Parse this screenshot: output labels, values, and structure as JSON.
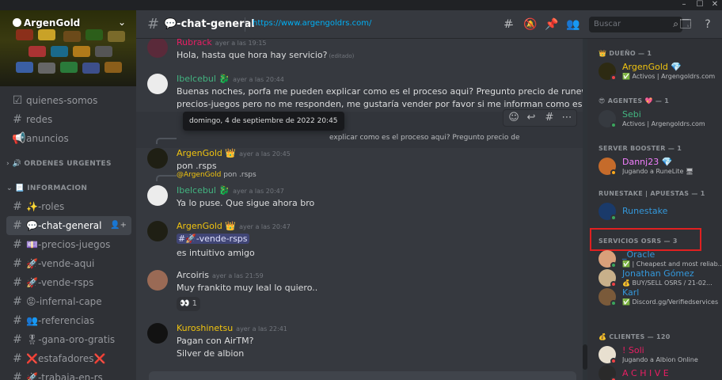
{
  "colors": {
    "accent": "#00aff4",
    "argengold": "#f1c40f",
    "green_user": "#43b581",
    "pink_user": "#f47fff",
    "online": "#3ba55d",
    "dnd": "#ed4245",
    "idle": "#faa81a",
    "highlight_box": "#e02020"
  },
  "window_controls": [
    "–",
    "☐",
    "✕"
  ],
  "server": {
    "name": "ArgenGold",
    "dropdown_icon": "chevron-down-icon"
  },
  "channels": [
    {
      "icon": "checklist-icon",
      "glyph": "☑",
      "label": "quienes-somos",
      "active": false
    },
    {
      "icon": "hash-icon",
      "glyph": "#",
      "label": "redes",
      "active": false
    },
    {
      "icon": "megaphone-icon",
      "glyph": "📢",
      "label": "anuncios",
      "active": false
    },
    {
      "category": true,
      "label": "› 🔊 ORDENES URGENTES"
    },
    {
      "category": true,
      "label": "⌄ 📃 INFORMACION"
    },
    {
      "icon": "hash-icon",
      "glyph": "#",
      "label": "✨-roles",
      "active": false
    },
    {
      "icon": "hash-icon",
      "glyph": "#",
      "label": "💬-chat-general",
      "active": true
    },
    {
      "icon": "hash-icon",
      "glyph": "#",
      "label": "💷-precios-juegos",
      "active": false
    },
    {
      "icon": "hash-icon",
      "glyph": "#",
      "label": "🚀-vende-aqui",
      "active": false
    },
    {
      "icon": "hash-icon",
      "glyph": "#",
      "label": "🚀-vende-rsps",
      "active": false
    },
    {
      "icon": "hash-icon",
      "glyph": "#",
      "label": "😡-infernal-cape",
      "active": false
    },
    {
      "icon": "hash-icon",
      "glyph": "#",
      "label": "👥-referencias",
      "active": false
    },
    {
      "icon": "hash-icon",
      "glyph": "#",
      "label": "🎖-gana-oro-gratis",
      "active": false
    },
    {
      "icon": "hash-icon",
      "glyph": "#",
      "label": "❌estafadores❌",
      "active": false
    },
    {
      "icon": "hash-icon",
      "glyph": "#",
      "label": "🚀-trabaja-en-rs",
      "active": false
    }
  ],
  "header": {
    "channel_name": "💬-chat-general",
    "topic": "https://www.argengoldrs.com/",
    "search_placeholder": "Buscar"
  },
  "messages": [
    {
      "author": "Rubrack",
      "color": "#e91e63",
      "timestamp": "ayer a las 19:15",
      "lines": [
        "Hola, hasta que hora hay servicio?"
      ],
      "edited": "(editado)"
    },
    {
      "author": "Ibelcebul",
      "badge": "🐉",
      "color": "#43b581",
      "timestamp": "ayer a las 20:44",
      "lines": [
        "Buenas noches, porfa me pueden explicar como es el proceso aqui? Pregunto precio de runewild en",
        "precios-juegos pero no me responden, me gustaría vender por favor si me informan como es todo"
      ]
    },
    {
      "reply": "explicar como es el proceso aqui? Pregunto precio de",
      "author": "ArgenGold",
      "badge": "👑",
      "color": "#f1c40f",
      "timestamp": "ayer a las 20:45",
      "lines": [
        "pon .rsps"
      ]
    },
    {
      "reply_author": "@ArgenGold",
      "reply": "pon .rsps",
      "author": "Ibelcebul",
      "badge": "🐉",
      "color": "#43b581",
      "timestamp": "ayer a las 20:47",
      "lines": [
        "Ya lo puse. Que sigue ahora bro"
      ]
    },
    {
      "author": "ArgenGold",
      "badge": "👑",
      "color": "#f1c40f",
      "timestamp": "ayer a las 20:47",
      "mention": "#🚀-vende-rsps",
      "lines": [
        "es intuitivo amigo"
      ]
    },
    {
      "author": "Arcoiris",
      "color": "#dcddde",
      "timestamp": "ayer a las 21:59",
      "lines": [
        "Muy frankito muy leal lo quiero.."
      ],
      "reaction": {
        "emoji": "👀",
        "count": "1"
      }
    },
    {
      "author": "Kuroshinetsu",
      "color": "#f1c40f",
      "timestamp": "ayer a las 22:41",
      "lines": [
        "Pagan con AirTM?",
        "Silver de albion"
      ]
    }
  ],
  "tooltip": "domingo, 4 de septiembre de 2022 20:45",
  "member_groups": [
    {
      "title": "👑 DUEÑO — 1",
      "members": [
        {
          "name": "ArgenGold",
          "name_suffix": "💎",
          "color": "#f1c40f",
          "activity": "✅ Activos | Argengoldrs.com",
          "status": "dnd"
        }
      ]
    },
    {
      "title": "😎 AGENTES 💖 — 1",
      "members": [
        {
          "name": "Sebi",
          "color": "#43b581",
          "activity": "Activos | Argengoldrs.com",
          "status": "online"
        }
      ]
    },
    {
      "title": "SERVER BOOSTER — 1",
      "members": [
        {
          "name": "Dannj23",
          "name_suffix": "💎",
          "color": "#f47fff",
          "activity": "Jugando a RuneLite 🖥",
          "status": "idle"
        }
      ]
    },
    {
      "title": "RUNESTAKE | APUESTAS — 1",
      "members": [
        {
          "name": "Runestake",
          "color": "#3498db",
          "activity": "",
          "status": "online"
        }
      ]
    },
    {
      "title": "SERVICIOS OSRS — 3",
      "members": [
        {
          "name": "_Oracle",
          "color": "#3498db",
          "activity": "✅ | Cheapest and most reliab...",
          "status": "online"
        },
        {
          "name": "Jonathan Gómez",
          "color": "#3498db",
          "activity": "💰 BUY/SELL OSRS / 21-02...",
          "status": "dnd"
        },
        {
          "name": "Karl",
          "color": "#3498db",
          "activity": "✅ Discord.gg/Verifiedservices",
          "status": "online"
        }
      ]
    },
    {
      "title": "💰 CLIENTES — 120",
      "members": [
        {
          "name": "! Soli",
          "color": "#e91e63",
          "activity": "Jugando a Albion Online",
          "status": "dnd"
        },
        {
          "name": "A C H I V E",
          "color": "#e91e63",
          "activity": "",
          "status": "dnd"
        }
      ]
    }
  ]
}
